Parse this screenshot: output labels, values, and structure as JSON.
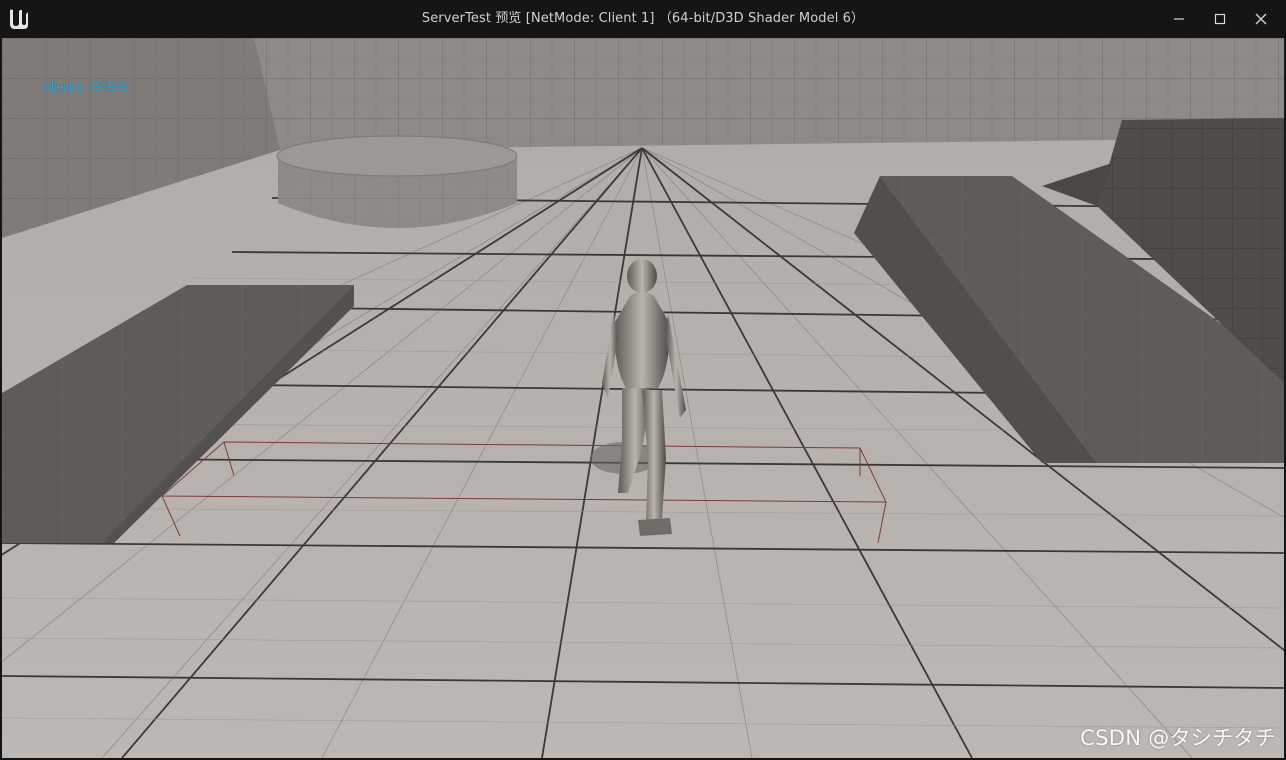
{
  "window": {
    "title": "ServerTest 预览 [NetMode: Client 1]  （64-bit/D3D Shader Model 6）",
    "logo_icon": "unreal-engine-logo",
    "buttons": {
      "minimize_icon": "minimize-icon",
      "maximize_icon": "maximize-icon",
      "close_icon": "close-icon"
    }
  },
  "viewport": {
    "overlay_text": "Client 1: 757575",
    "overlay_color": "#29b6e6",
    "floor_color": "#b9b3b0",
    "wall_color": "#8f8b88",
    "block_color": "#5c5855"
  },
  "watermark": "CSDN @タシチタチ"
}
